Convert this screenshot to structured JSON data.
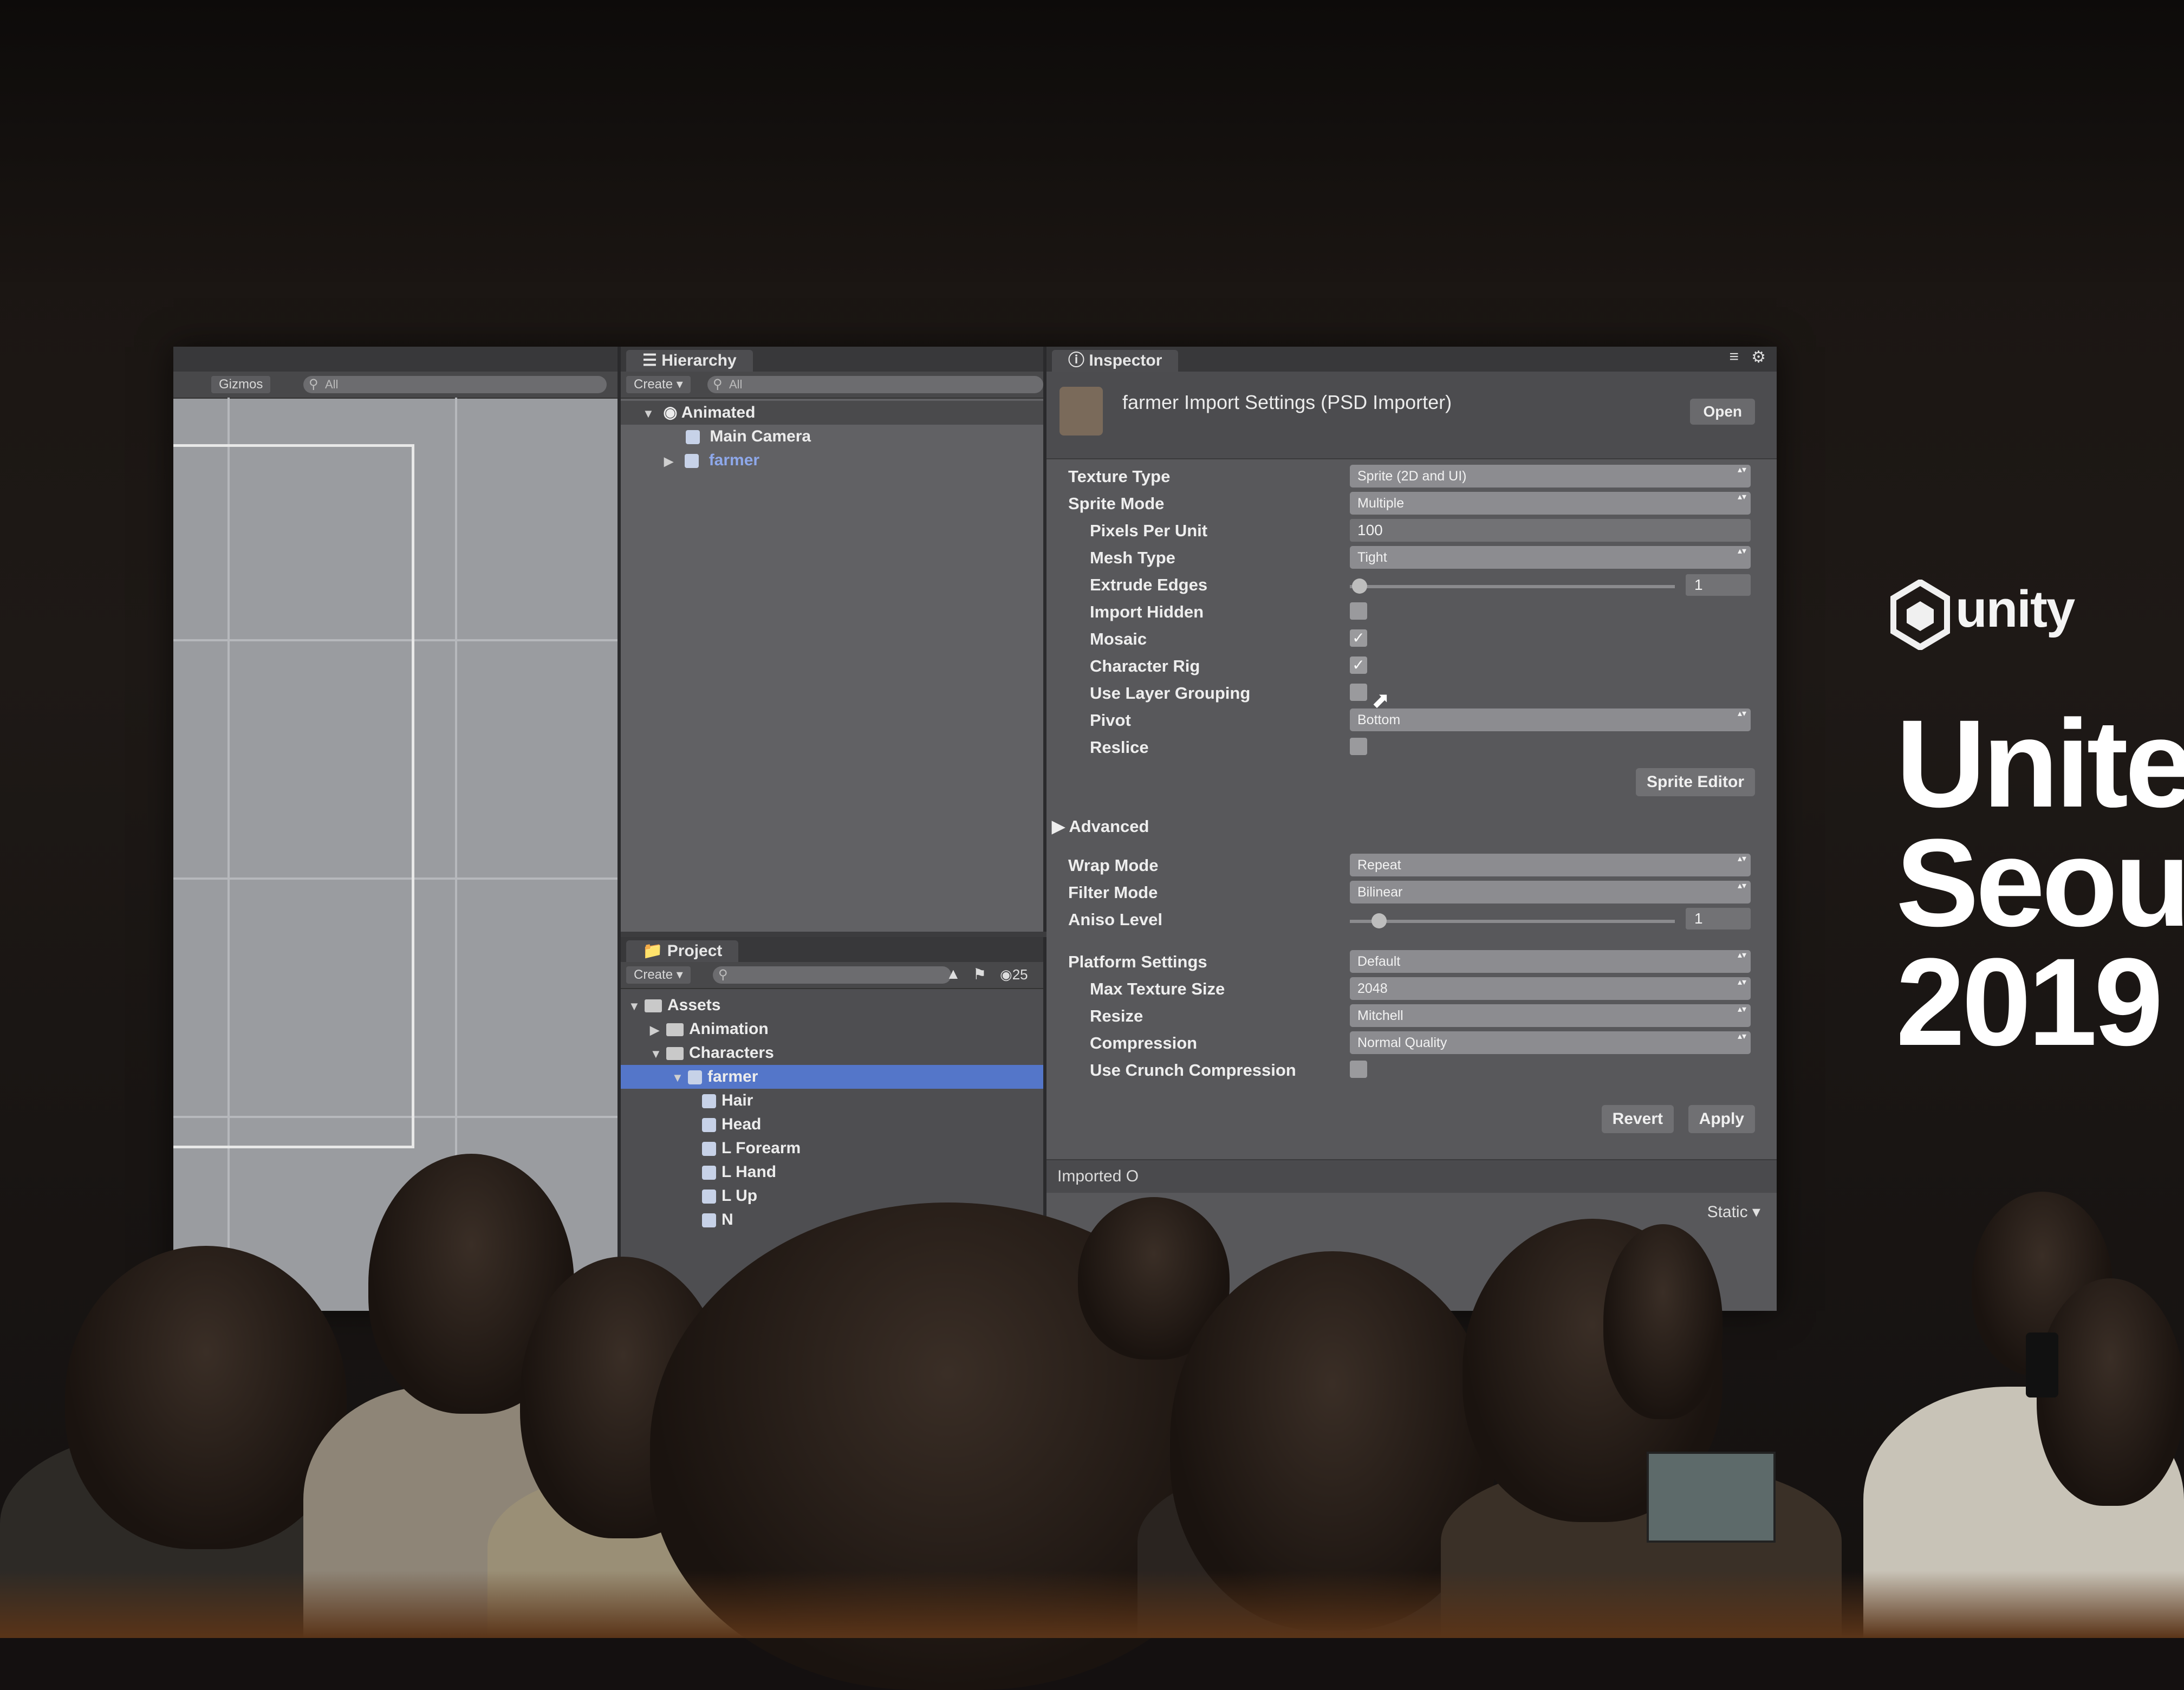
{
  "scene_view": {
    "toolbar": {
      "gizmos_label": "Gizmos",
      "search_placeholder": "All"
    }
  },
  "hierarchy": {
    "tab_label": "Hierarchy",
    "create_label": "Create",
    "search_placeholder": "All",
    "scene_name": "Animated",
    "items": [
      {
        "label": "Main Camera"
      },
      {
        "label": "farmer"
      }
    ]
  },
  "project": {
    "tab_label": "Project",
    "create_label": "Create",
    "badge_count": "25",
    "tree": [
      {
        "label": "Assets"
      },
      {
        "label": "Animation"
      },
      {
        "label": "Characters"
      },
      {
        "label": "farmer"
      },
      {
        "label": "Hair"
      },
      {
        "label": "Head"
      },
      {
        "label": "L Forearm"
      },
      {
        "label": "L Hand"
      },
      {
        "label": "L Up"
      },
      {
        "label": "N"
      }
    ]
  },
  "inspector": {
    "tab_label": "Inspector",
    "title": "farmer Import Settings (PSD Importer)",
    "open_label": "Open",
    "props": {
      "texture_type": {
        "label": "Texture Type",
        "value": "Sprite (2D and UI)"
      },
      "sprite_mode": {
        "label": "Sprite Mode",
        "value": "Multiple"
      },
      "pixels_per_unit": {
        "label": "Pixels Per Unit",
        "value": "100"
      },
      "mesh_type": {
        "label": "Mesh Type",
        "value": "Tight"
      },
      "extrude_edges": {
        "label": "Extrude Edges",
        "value": "1"
      },
      "import_hidden": {
        "label": "Import Hidden"
      },
      "mosaic": {
        "label": "Mosaic"
      },
      "character_rig": {
        "label": "Character Rig"
      },
      "use_layer_grouping": {
        "label": "Use Layer Grouping"
      },
      "pivot": {
        "label": "Pivot",
        "value": "Bottom"
      },
      "reslice": {
        "label": "Reslice"
      },
      "sprite_editor_label": "Sprite Editor",
      "advanced_label": "Advanced",
      "wrap_mode": {
        "label": "Wrap Mode",
        "value": "Repeat"
      },
      "filter_mode": {
        "label": "Filter Mode",
        "value": "Bilinear"
      },
      "aniso_level": {
        "label": "Aniso Level",
        "value": "1"
      },
      "platform_settings": {
        "label": "Platform Settings",
        "value": "Default"
      },
      "max_texture_size": {
        "label": "Max Texture Size",
        "value": "2048"
      },
      "resize": {
        "label": "Resize",
        "value": "Mitchell"
      },
      "compression": {
        "label": "Compression",
        "value": "Normal Quality"
      },
      "use_crunch": {
        "label": "Use Crunch Compression"
      }
    },
    "revert_label": "Revert",
    "apply_label": "Apply",
    "imported_objects_label": "Imported O",
    "static_label": "Static"
  },
  "checkboxes": {
    "import_hidden": false,
    "mosaic": true,
    "character_rig": true,
    "use_layer_grouping": false,
    "reslice": false,
    "use_crunch": false
  },
  "branding": {
    "logo_word": "unity",
    "event_lines": [
      "Unite",
      "Seou",
      "2019"
    ]
  },
  "colors": {
    "selection": "#5476c9",
    "editor_bg": "#58585b",
    "stage_bg": "#141010"
  }
}
